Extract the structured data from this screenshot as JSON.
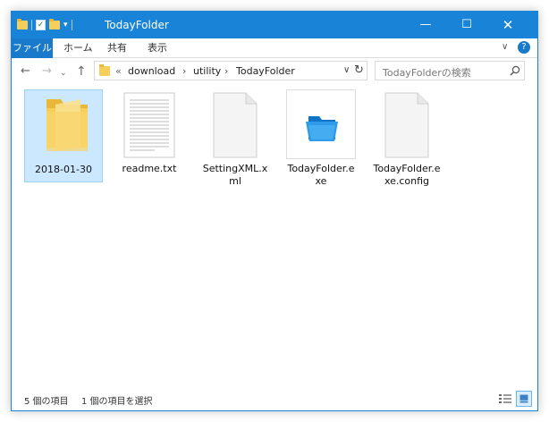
{
  "window": {
    "title": "TodayFolder"
  },
  "title_buttons": {
    "minimize": "—",
    "maximize": "☐",
    "close": "✕"
  },
  "quick_access": {
    "check": "✓",
    "dropdown": "▾"
  },
  "ribbon": {
    "tabs": [
      {
        "label": "ファイル",
        "active": true
      },
      {
        "label": "ホーム"
      },
      {
        "label": "共有"
      },
      {
        "label": "表示"
      }
    ],
    "collapse_glyph": "∨",
    "help_glyph": "?"
  },
  "nav": {
    "back": "←",
    "forward": "→",
    "recent": "⌄",
    "up": "↑"
  },
  "address": {
    "overflow": "«",
    "crumbs": [
      "download",
      "utility",
      "TodayFolder"
    ],
    "separator": "›",
    "dropdown": "∨",
    "refresh": "↻"
  },
  "search": {
    "placeholder": "TodayFolderの検索"
  },
  "items": [
    {
      "name": "2018-01-30",
      "type": "folder",
      "selected": true
    },
    {
      "name": "readme.txt",
      "type": "text"
    },
    {
      "name": "SettingXML.xml",
      "type": "blank"
    },
    {
      "name": "TodayFolder.exe",
      "type": "exe"
    },
    {
      "name": "TodayFolder.exe.config",
      "type": "blank"
    }
  ],
  "status": {
    "count": "5 個の項目",
    "selected": "1 個の項目を選択"
  },
  "colors": {
    "accent": "#1883d7",
    "selection": "#cce8ff",
    "folder": "#f6cf5b"
  }
}
